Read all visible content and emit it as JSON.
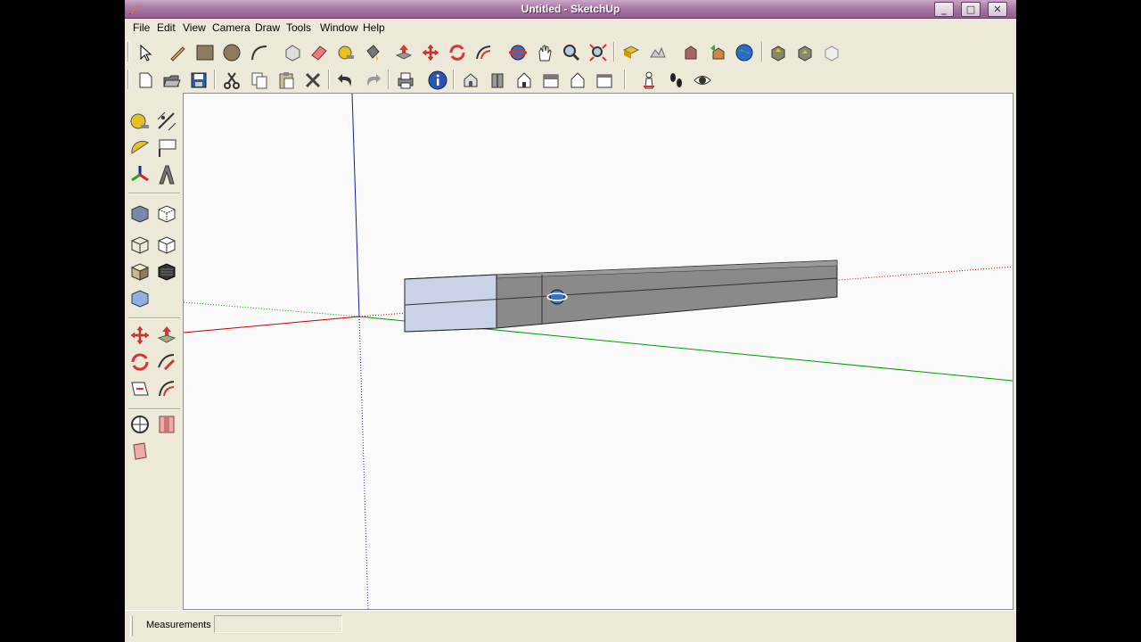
{
  "window": {
    "title": "Untitled - SketchUp",
    "controls": {
      "minimize": "_",
      "maximize": "□",
      "close": "✕"
    }
  },
  "menubar": {
    "items": [
      "File",
      "Edit",
      "View",
      "Camera",
      "Draw",
      "Tools",
      "Window",
      "Help"
    ]
  },
  "toolbar_top": {
    "icons": [
      "select-icon",
      "pencil-line-icon",
      "rectangle-icon",
      "circle-icon",
      "arc-icon",
      "make-component-icon",
      "eraser-icon",
      "tape-measure-icon",
      "paint-bucket-icon",
      "push-pull-icon",
      "move-icon",
      "rotate-icon",
      "follow-me-icon",
      "orbit-icon",
      "pan-icon",
      "zoom-icon",
      "zoom-extents-icon",
      "add-location-icon",
      "toggle-terrain-icon",
      "get-models-icon",
      "share-model-icon",
      "google-earth-icon",
      "get-photo-texture-icon",
      "preview-in-earth-icon",
      "share-component-icon"
    ]
  },
  "toolbar_second": {
    "icons": [
      "new-icon",
      "open-icon",
      "save-icon",
      "cut-icon",
      "copy-icon",
      "paste-icon",
      "erase-icon",
      "undo-icon",
      "redo-icon",
      "print-icon",
      "model-info-icon",
      "iso-view-icon",
      "top-view-icon",
      "front-view-icon",
      "right-view-icon",
      "back-view-icon",
      "left-view-icon",
      "position-camera-icon",
      "walk-icon",
      "look-around-icon"
    ]
  },
  "left_toolbar": {
    "icons": [
      "tape-measure-icon",
      "dimension-icon",
      "protractor-icon",
      "text-icon",
      "axes-icon",
      "3d-text-icon",
      "xray-icon",
      "back-edges-icon",
      "wireframe-icon",
      "hidden-line-icon",
      "shaded-icon",
      "shaded-textures-icon",
      "monochrome-icon",
      "move-icon",
      "push-pull-icon",
      "rotate-icon",
      "scale-icon",
      "offset-icon",
      "follow-me-icon",
      "section-plane-icon",
      "display-section-planes-icon",
      "display-section-cuts-icon"
    ]
  },
  "status": {
    "measurements_label": "Measurements",
    "measurements_value": ""
  },
  "colors": {
    "title_bar": "#a87aa4",
    "chrome": "#ece9d8",
    "viewport": "#fafafa",
    "red_axis": "#c00000",
    "green_axis": "#009900",
    "blue_axis": "#1a1aa0",
    "model_gray": "#8a8a8a",
    "model_face_selected": "#c9d2e6"
  }
}
